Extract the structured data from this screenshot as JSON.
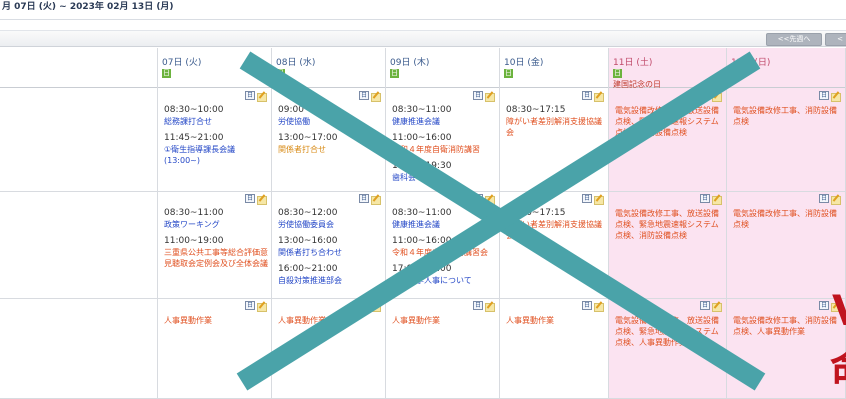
{
  "header": {
    "date_range": "月 07日 (火) ~ 2023年 02月 13日 (月)"
  },
  "toolbar": {
    "prev_week": "<<先週へ",
    "prev2": "<"
  },
  "columns": [
    {
      "date": "07日 (火)",
      "badge": "日",
      "holiday": "",
      "rows": [
        [
          {
            "time": "08:30~10:00",
            "title": "総務課打合せ",
            "color": "blue"
          },
          {
            "time": "11:45~21:00",
            "title": "①衛生指導課長会議 (13:00~)",
            "color": "blue"
          }
        ],
        [
          {
            "time": "08:30~11:00",
            "title": "政策ワーキング",
            "color": "blue"
          },
          {
            "time": "11:00~19:00",
            "title": "三重県公共工事等総合評価意見聴取会定例会及び全体会議",
            "color": "red"
          }
        ],
        [
          {
            "time": "",
            "title": "人事異動作業",
            "color": "red"
          }
        ]
      ]
    },
    {
      "date": "08日 (水)",
      "badge": "日",
      "holiday": "",
      "rows": [
        [
          {
            "time": "09:00",
            "title": "労使協働",
            "color": "blue"
          },
          {
            "time": "13:00~17:00",
            "title": "関係者打合せ",
            "color": "orange"
          }
        ],
        [
          {
            "time": "08:30~12:00",
            "title": "労使協働委員会",
            "color": "blue"
          },
          {
            "time": "13:00~16:00",
            "title": "関係者打ち合わせ",
            "color": "blue"
          },
          {
            "time": "16:00~21:00",
            "title": "自殺対策推進部会",
            "color": "blue"
          }
        ],
        [
          {
            "time": "",
            "title": "人事異動作業",
            "color": "red"
          }
        ]
      ]
    },
    {
      "date": "09日 (木)",
      "badge": "日",
      "holiday": "",
      "rows": [
        [
          {
            "time": "08:30~11:00",
            "title": "健康推進会議",
            "color": "blue"
          },
          {
            "time": "11:00~16:00",
            "title": "令和４年度自衛消防講習",
            "color": "red"
          },
          {
            "time": "16:00~19:30",
            "title": "歯科会",
            "color": "blue"
          }
        ],
        [
          {
            "time": "08:30~11:00",
            "title": "健康推進会議",
            "color": "blue"
          },
          {
            "time": "11:00~16:00",
            "title": "令和４年度自衛消防講習会",
            "color": "red"
          },
          {
            "time": "17:00~18:00",
            "title": "医科大学人事について",
            "color": "blue"
          }
        ],
        [
          {
            "time": "",
            "title": "人事異動作業",
            "color": "red"
          }
        ]
      ]
    },
    {
      "date": "10日 (金)",
      "badge": "日",
      "holiday": "",
      "rows": [
        [
          {
            "time": "08:30~17:15",
            "title": "障がい者差別解消支援協議会",
            "color": "red"
          }
        ],
        [
          {
            "time": "08:30~17:15",
            "title": "障がい者差別解消支援協議会",
            "color": "red"
          }
        ],
        [
          {
            "time": "",
            "title": "人事異動作業",
            "color": "red"
          }
        ]
      ]
    },
    {
      "date": "11日 (土)",
      "badge": "日",
      "holiday": "建国記念の日",
      "rows": [
        [
          {
            "time": "",
            "title": "電気設備改修工事、放送設備点検、緊急地震速報システム点検、消防設備点検",
            "color": "red"
          }
        ],
        [
          {
            "time": "",
            "title": "電気設備改修工事、放送設備点検、緊急地震速報システム点検、消防設備点検",
            "color": "red"
          }
        ],
        [
          {
            "time": "",
            "title": "電気設備改修工事、放送設備点検、緊急地震速報システム点検、人事異動作業",
            "color": "red"
          }
        ]
      ]
    },
    {
      "date": "12日 (日)",
      "badge": "",
      "holiday": "",
      "rows": [
        [
          {
            "time": "",
            "title": "電気設備改修工事、消防設備点検",
            "color": "red"
          }
        ],
        [
          {
            "time": "",
            "title": "電気設備改修工事、消防設備点検",
            "color": "red"
          }
        ],
        [
          {
            "time": "",
            "title": "電気設備改修工事、消防設備点検、人事異動作業",
            "color": "red"
          }
        ]
      ]
    }
  ],
  "colors": {
    "cross": "#4aa3a9",
    "weekend_bg": "#fbe3f1",
    "accent_red": "#c0141e"
  },
  "overlay": {
    "glyph1": "V",
    "glyph2": "命"
  }
}
